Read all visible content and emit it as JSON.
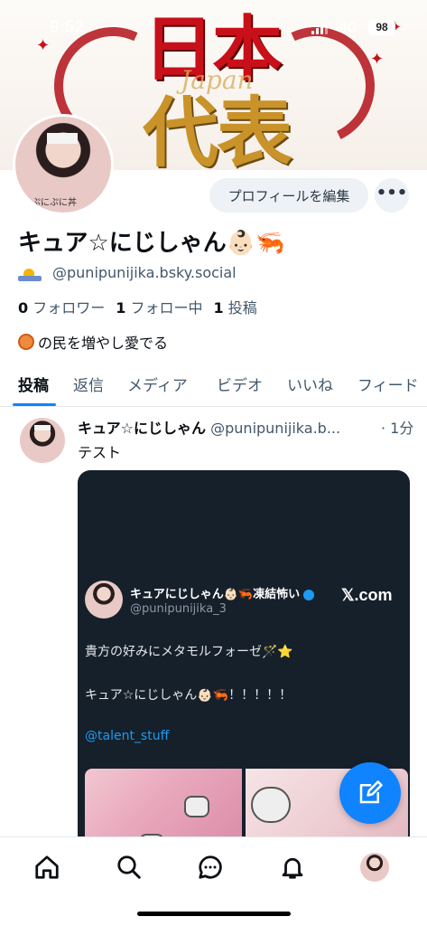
{
  "status_bar": {
    "time": "9:52",
    "network": "4G",
    "battery": "98"
  },
  "banner": {
    "line1": "日本",
    "line2": "代表",
    "script": "Japan"
  },
  "profile": {
    "avatar_caption": "ぷにぷに丼",
    "edit_button": "プロフィールを編集",
    "more_button": "•••",
    "display_name": "キュア☆にじしゃん👶🏻🦐",
    "handle": "@punipunijika.bsky.social",
    "followers_count": "0",
    "followers_label": "フォロワー",
    "following_count": "1",
    "following_label": "フォロー中",
    "posts_count": "1",
    "posts_label": "投稿",
    "bio": "の民を増やし愛でる"
  },
  "tabs": [
    "投稿",
    "返信",
    "メディア",
    "ビデオ",
    "いいね",
    "フィード"
  ],
  "post": {
    "author_name": "キュア☆にじしゃん",
    "author_handle": "@punipunijika.b...",
    "time": "· 1分",
    "text": "テスト",
    "embed": {
      "name": "キュアにじしゃん👶🏻🦐凍結怖い",
      "handle": "@punipunijika_3",
      "source": "𝕏.com",
      "line1": "貴方の好みにメタモルフォーゼ🪄⭐",
      "line2": "キュア☆にじしゃん👶🏻🦐！！！！！",
      "link": "@talent_stuff"
    }
  },
  "colors": {
    "accent": "#1083fe",
    "muted": "#42576c",
    "banner_red": "#c8101a",
    "banner_gold": "#c9932a"
  }
}
